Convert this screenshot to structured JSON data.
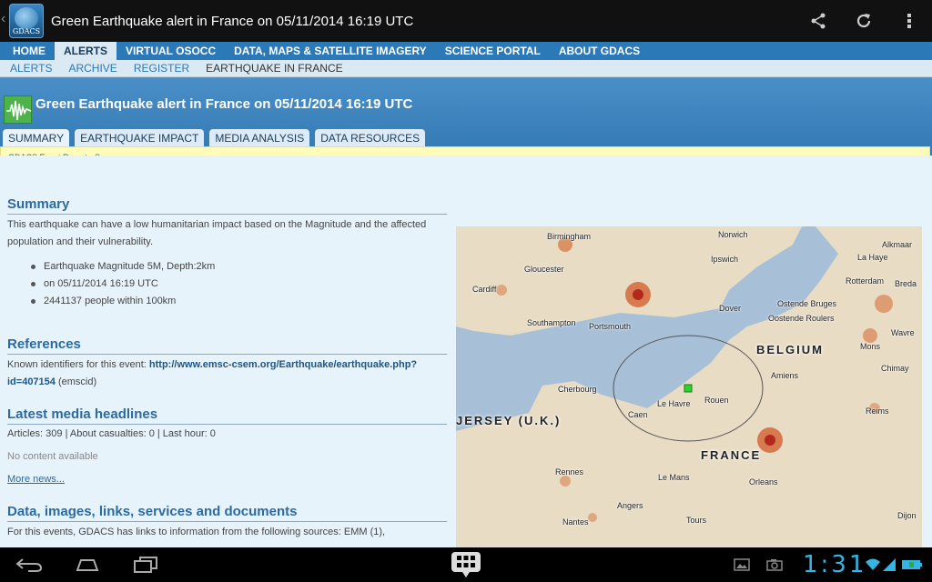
{
  "actionbar": {
    "title": "Green Earthquake alert in France on 05/11/2014 16:19 UTC",
    "app_icon_text": "GDACS",
    "icons": [
      "share-icon",
      "refresh-icon",
      "overflow-menu-icon"
    ]
  },
  "topnav": [
    {
      "label": "HOME",
      "active": false
    },
    {
      "label": "ALERTS",
      "active": true
    },
    {
      "label": "VIRTUAL OSOCC",
      "active": false
    },
    {
      "label": "DATA, MAPS & SATELLITE IMAGERY",
      "active": false
    },
    {
      "label": "SCIENCE PORTAL",
      "active": false
    },
    {
      "label": "ABOUT GDACS",
      "active": false
    }
  ],
  "subnav": [
    {
      "label": "ALERTS"
    },
    {
      "label": "ARCHIVE"
    },
    {
      "label": "REGISTER"
    },
    {
      "label": "EARTHQUAKE IN FRANCE"
    }
  ],
  "header": {
    "title": "Green Earthquake alert in France on 05/11/2014 16:19 UTC",
    "tabs": [
      {
        "label": "SUMMARY",
        "active": true
      },
      {
        "label": "EARTHQUAKE IMPACT",
        "active": false
      },
      {
        "label": "MEDIA ANALYSIS",
        "active": false
      },
      {
        "label": "DATA RESOURCES",
        "active": false
      }
    ],
    "breadcrumb": "GDACS Event Report - Summary"
  },
  "summary": {
    "heading": "Summary",
    "text": "This earthquake can have a low humanitarian impact based on the Magnitude and the affected population and their vulnerability.",
    "bullets": [
      "Earthquake Magnitude 5M, Depth:2km",
      "on 05/11/2014 16:19 UTC",
      "2441137 people within 100km"
    ]
  },
  "references": {
    "heading": "References",
    "prefix": "Known identifiers for this event:",
    "link": "http://www.emsc-csem.org/Earthquake/earthquake.php?id=407154",
    "suffix": "(emscid)"
  },
  "media": {
    "heading": "Latest media headlines",
    "stats": "Articles: 309 | About casualties: 0 | Last hour: 0",
    "empty": "No content available",
    "more": "More news..."
  },
  "data_section": {
    "heading": "Data, images, links, services and documents",
    "text": "For this events, GDACS has links to information from the following sources: EMM (1),"
  },
  "map": {
    "cities": [
      "Birmingham",
      "Norwich",
      "Gloucester",
      "Ipswich",
      "Cardiff",
      "Southampton",
      "Portsmouth",
      "Dover",
      "Ostende Bruges",
      "Oostende Roulers",
      "Rotterdam",
      "Breda",
      "Alkmaar",
      "La Haye",
      "Amiens",
      "Cherbourg",
      "Caen",
      "Le Havre",
      "Rouen",
      "Reims",
      "Rennes",
      "Le Mans",
      "Orleans",
      "Angers",
      "Nantes",
      "Tours",
      "Mons",
      "Wavre",
      "Chimay",
      "Dijon"
    ],
    "countries": [
      "BELGIUM",
      "JERSEY (U.K.)",
      "FRANCE"
    ]
  },
  "statusbar": {
    "time": "1:31"
  }
}
